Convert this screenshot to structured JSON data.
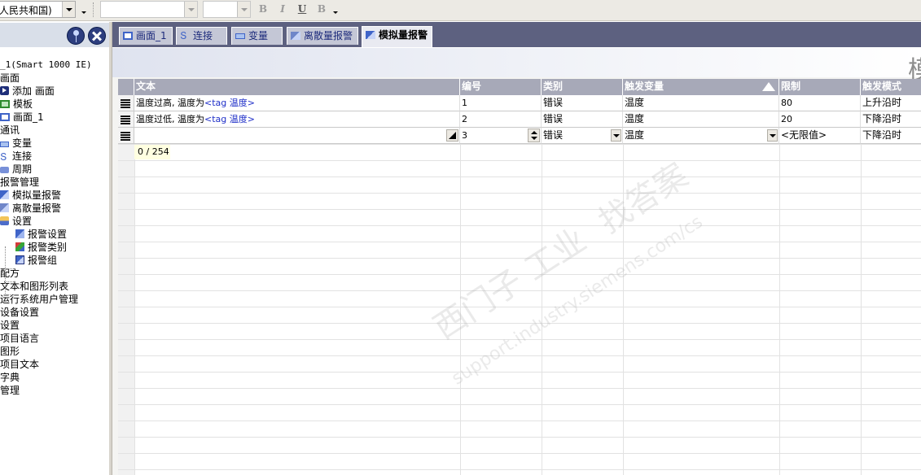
{
  "toolbar": {
    "language_value": "人民共和国)",
    "fmt_bold": "B",
    "fmt_italic": "I",
    "fmt_underline": "U",
    "fmt_flash": "B"
  },
  "tree": {
    "items": [
      {
        "label": "_1(Smart 1000 IE)"
      },
      {
        "label": "画面"
      },
      {
        "label": "添加 画面"
      },
      {
        "label": "模板"
      },
      {
        "label": "画面_1"
      },
      {
        "label": "通讯"
      },
      {
        "label": "变量"
      },
      {
        "label": "连接"
      },
      {
        "label": "周期"
      },
      {
        "label": "报警管理"
      },
      {
        "label": "模拟量报警"
      },
      {
        "label": "离散量报警"
      },
      {
        "label": "设置"
      },
      {
        "label": "报警设置"
      },
      {
        "label": "报警类别"
      },
      {
        "label": "报警组"
      },
      {
        "label": "配方"
      },
      {
        "label": "文本和图形列表"
      },
      {
        "label": "运行系统用户管理"
      },
      {
        "label": "设备设置"
      },
      {
        "label": "设置"
      },
      {
        "label": "项目语言"
      },
      {
        "label": "图形"
      },
      {
        "label": "项目文本"
      },
      {
        "label": "字典"
      },
      {
        "label": "管理"
      }
    ]
  },
  "tabs": [
    {
      "label": "画面_1"
    },
    {
      "label": "连接"
    },
    {
      "label": "变量"
    },
    {
      "label": "离散量报警"
    },
    {
      "label": "模拟量报警"
    }
  ],
  "editor": {
    "title": "模"
  },
  "grid": {
    "columns": [
      {
        "label": "文本"
      },
      {
        "label": "编号"
      },
      {
        "label": "类别"
      },
      {
        "label": "触发变量"
      },
      {
        "label": "限制"
      },
      {
        "label": "触发模式"
      }
    ],
    "rows": [
      {
        "text": "温度过高, 温度为",
        "tag": "<tag 温度>",
        "number": "1",
        "category": "错误",
        "trigger_tag": "温度",
        "limit": "80",
        "mode": "上升沿时"
      },
      {
        "text": "温度过低, 温度为",
        "tag": "<tag 温度>",
        "number": "2",
        "category": "错误",
        "trigger_tag": "温度",
        "limit": "20",
        "mode": "下降沿时"
      },
      {
        "text": "",
        "tag": "",
        "number": "3",
        "category": "错误",
        "trigger_tag": "温度",
        "limit": "<无限值>",
        "mode": "下降沿时"
      }
    ],
    "char_counter": "0 / 254"
  },
  "watermark": {
    "cn": "西门子 工业",
    "cn2": "找答案",
    "url": "support.industry.siemens.com/cs"
  },
  "colors": {
    "tabbar": "#5d6180",
    "column_header": "#a7a9b8",
    "tag_link": "#1f2fc8",
    "active_tab": "#e9eaf1",
    "panel_header": "#d9dfe9"
  }
}
